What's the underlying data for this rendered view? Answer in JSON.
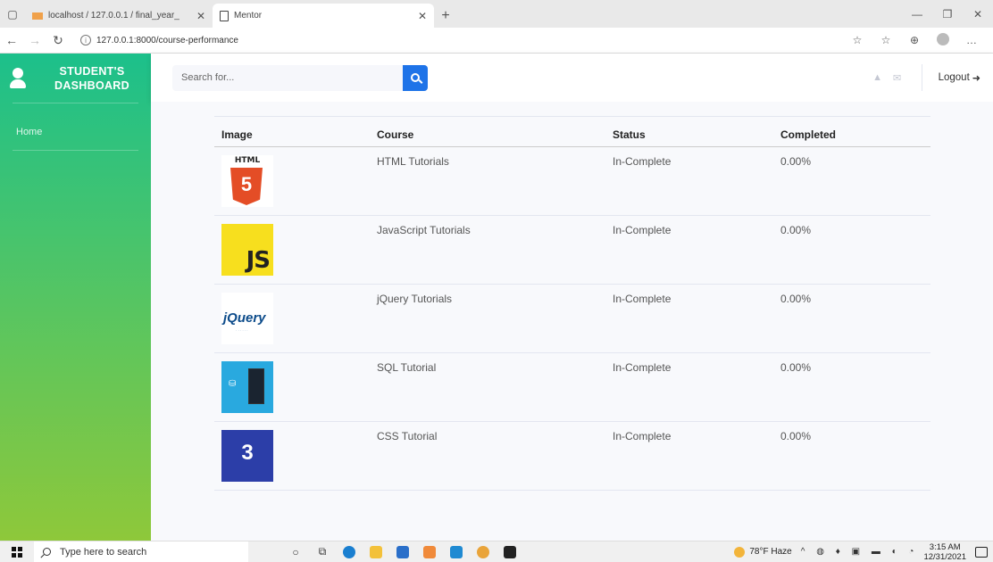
{
  "browser": {
    "tabs": [
      {
        "title": "localhost / 127.0.0.1 / final_year_",
        "active": false
      },
      {
        "title": "Mentor",
        "active": true
      }
    ],
    "url": "127.0.0.1:8000/course-performance"
  },
  "sidebar": {
    "brand_line1": "STUDENT'S",
    "brand_line2": "DASHBOARD",
    "items": [
      {
        "label": "Home"
      }
    ]
  },
  "topbar": {
    "search_placeholder": "Search for...",
    "logout_label": "Logout"
  },
  "table": {
    "headers": [
      "Image",
      "Course",
      "Status",
      "Completed"
    ],
    "rows": [
      {
        "image_text": "HTML",
        "image_icon": "html5-logo",
        "course": "HTML Tutorials",
        "status": "In-Complete",
        "completed": "0.00%"
      },
      {
        "image_text": "JS",
        "image_icon": "javascript-logo",
        "course": "JavaScript Tutorials",
        "status": "In-Complete",
        "completed": "0.00%"
      },
      {
        "image_text": "jQuery",
        "image_icon": "jquery-logo",
        "course": "jQuery Tutorials",
        "status": "In-Complete",
        "completed": "0.00%"
      },
      {
        "image_text": "",
        "image_icon": "sql-thumbnail",
        "course": "SQL Tutorial",
        "status": "In-Complete",
        "completed": "0.00%"
      },
      {
        "image_text": "",
        "image_icon": "css3-thumbnail",
        "course": "CSS Tutorial",
        "status": "In-Complete",
        "completed": "0.00%"
      }
    ]
  },
  "taskbar": {
    "search_placeholder": "Type here to search",
    "weather": "78°F Haze",
    "time": "3:15 AM",
    "date": "12/31/2021"
  },
  "colors": {
    "sidebar_top": "#1cc08b",
    "sidebar_bottom": "#8ec83a",
    "search_button": "#1e73e8"
  }
}
